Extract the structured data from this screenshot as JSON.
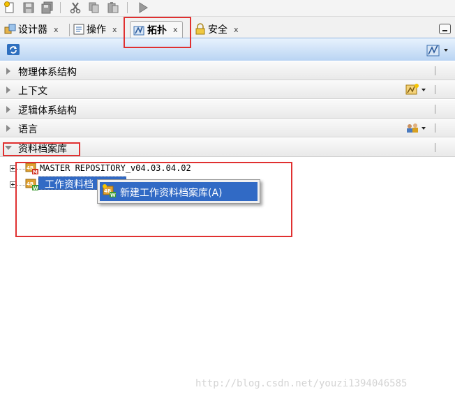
{
  "toolbar": {
    "buttons": [
      "new-icon",
      "save-icon",
      "save-all-icon",
      "cut-icon",
      "copy-icon",
      "paste-icon",
      "run-icon"
    ]
  },
  "tabs": [
    {
      "label": "设计器",
      "close": "x",
      "icon": "designer-icon"
    },
    {
      "label": "操作",
      "close": "x",
      "icon": "operations-icon"
    },
    {
      "label": "拓扑",
      "close": "x",
      "icon": "topology-icon",
      "active": true
    },
    {
      "label": "安全",
      "close": "x",
      "icon": "security-icon"
    }
  ],
  "sections": [
    {
      "label": "物理体系结构",
      "expanded": false
    },
    {
      "label": "上下文",
      "expanded": false
    },
    {
      "label": "逻辑体系结构",
      "expanded": false
    },
    {
      "label": "语言",
      "expanded": false
    },
    {
      "label": "资料档案库",
      "expanded": true
    }
  ],
  "tree": {
    "items": [
      {
        "label": "MASTER REPOSITORY_v04.03.04.02",
        "badge": "M"
      },
      {
        "label": "工作资料档",
        "badge": "W"
      }
    ]
  },
  "context_menu": {
    "item": "新建工作资料档案库(A)"
  },
  "watermark": "http://blog.csdn.net/youzi1394046585",
  "colors": {
    "selection": "#316ac5",
    "annotation": "#e03030",
    "header_gradient_top": "#e8f2fd",
    "header_gradient_bottom": "#b9d4f3"
  }
}
